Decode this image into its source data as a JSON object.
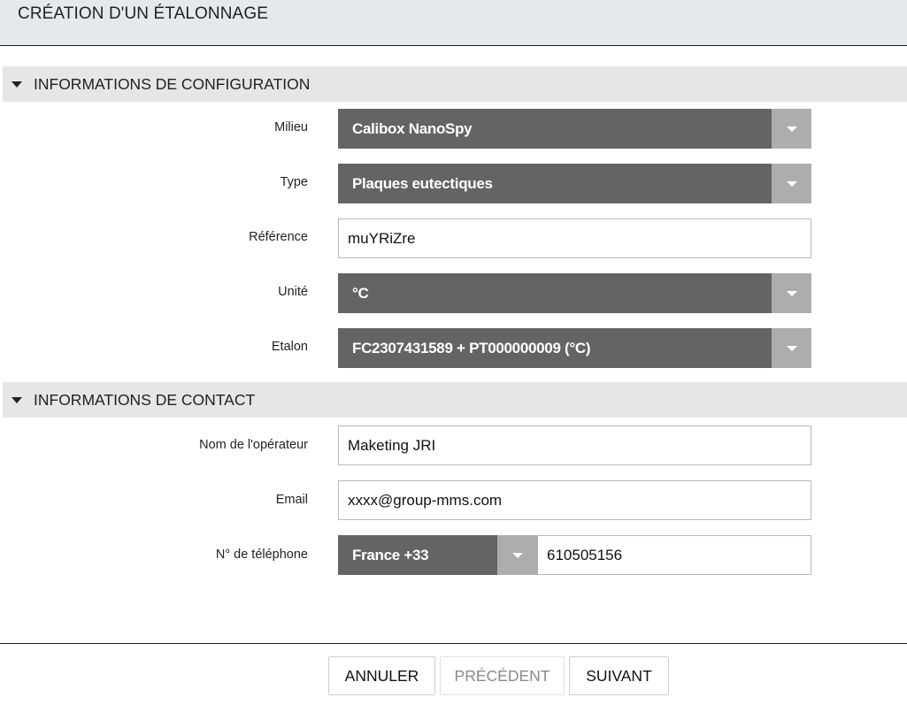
{
  "header": {
    "title": "CRÉATION D'UN ÉTALONNAGE"
  },
  "config_section": {
    "title": "INFORMATIONS DE CONFIGURATION",
    "fields": {
      "milieu": {
        "label": "Milieu",
        "value": "Calibox NanoSpy"
      },
      "type": {
        "label": "Type",
        "value": "Plaques eutectiques"
      },
      "reference": {
        "label": "Référence",
        "value": "muYRiZre"
      },
      "unite": {
        "label": "Unité",
        "value": "°C"
      },
      "etalon": {
        "label": "Etalon",
        "value": "FC2307431589 + PT000000009 (°C)"
      }
    }
  },
  "contact_section": {
    "title": "INFORMATIONS DE CONTACT",
    "fields": {
      "operateur": {
        "label": "Nom de l'opérateur",
        "value": "Maketing JRI"
      },
      "email": {
        "label": "Email",
        "value": "xxxx@group-mms.com"
      },
      "telephone": {
        "label": "N° de téléphone",
        "country": "France +33",
        "number": "610505156"
      }
    }
  },
  "footer": {
    "cancel_label": "ANNULER",
    "previous_label": "PRÉCÉDENT",
    "next_label": "SUIVANT"
  }
}
